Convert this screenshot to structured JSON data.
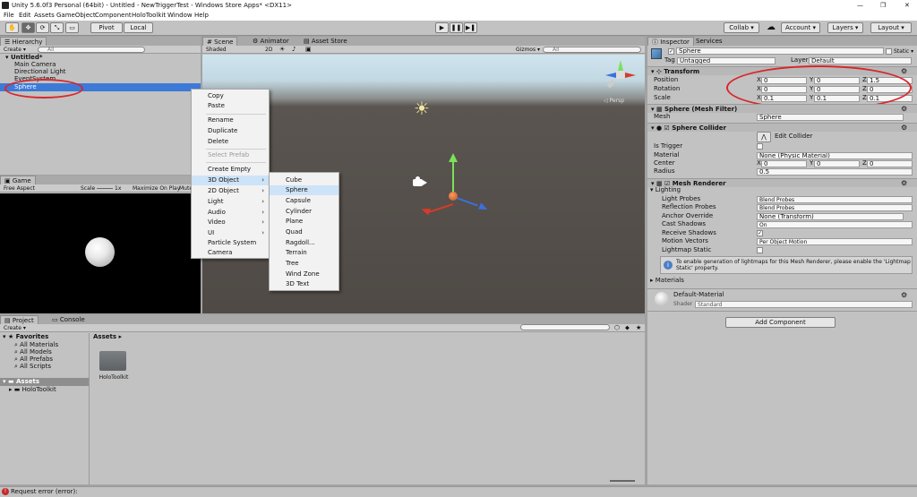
{
  "window": {
    "title": "Unity 5.6.0f3 Personal (64bit) - Untitled - NewTriggerTest - Windows Store Apps* <DX11>",
    "controls": [
      "—",
      "❐",
      "✕"
    ]
  },
  "menubar": [
    "File",
    "Edit",
    "Assets",
    "GameObject",
    "Component",
    "HoloToolkit",
    "Window",
    "Help"
  ],
  "toolbar": {
    "tools": [
      "✋",
      "✥",
      "⟳",
      "⤡",
      "▭"
    ],
    "pivot": "Pivot",
    "local": "Local",
    "play": [
      "▶",
      "❚❚",
      "▶❚"
    ],
    "collab": "Collab ▾",
    "cloud": "☁",
    "account": "Account ▾",
    "layers": "Layers ▾",
    "layout": "Layout ▾"
  },
  "hierarchy": {
    "tab": "Hierarchy",
    "create": "Create ▾",
    "search_placeholder": "All",
    "scene": "Untitled*",
    "items": [
      "Main Camera",
      "Directional Light",
      "EventSystem",
      "Sphere"
    ]
  },
  "game": {
    "tab": "Game",
    "aspect": "Free Aspect",
    "scale_label": "Scale",
    "scale_value": "1x",
    "maximize": "Maximize On Play",
    "mute": "Mute"
  },
  "scene": {
    "tabs": [
      "Scene",
      "Animator",
      "Asset Store"
    ],
    "shading": "Shaded",
    "mode_2d": "2D",
    "gizmos": "Gizmos ▾",
    "search_placeholder": "All",
    "persp": "◁ Persp"
  },
  "context_menu": {
    "items": [
      "Copy",
      "Paste",
      "Rename",
      "Duplicate",
      "Delete",
      "Select Prefab",
      "Create Empty",
      "3D Object",
      "2D Object",
      "Light",
      "Audio",
      "Video",
      "UI",
      "Particle System",
      "Camera"
    ],
    "arrow": "›"
  },
  "submenu_3d": {
    "items": [
      "Cube",
      "Sphere",
      "Capsule",
      "Cylinder",
      "Plane",
      "Quad",
      "Ragdoll...",
      "Terrain",
      "Tree",
      "Wind Zone",
      "3D Text"
    ]
  },
  "inspector": {
    "tabs": [
      "Inspector",
      "Services"
    ],
    "object_name": "Sphere",
    "static": "Static ▾",
    "tag_label": "Tag",
    "tag_value": "Untagged",
    "layer_label": "Layer",
    "layer_value": "Default",
    "transform": {
      "header": "Transform",
      "position_label": "Position",
      "rotation_label": "Rotation",
      "scale_label": "Scale",
      "position": [
        "0",
        "0",
        "1.5"
      ],
      "rotation": [
        "0",
        "0",
        "0"
      ],
      "scale": [
        "0.1",
        "0.1",
        "0.1"
      ],
      "axes": [
        "X",
        "Y",
        "Z"
      ]
    },
    "mesh_filter": {
      "header": "Sphere (Mesh Filter)",
      "mesh_label": "Mesh",
      "mesh_value": "Sphere"
    },
    "collider": {
      "header": "Sphere Collider",
      "edit_label": "Edit Collider",
      "is_trigger": "Is Trigger",
      "material_label": "Material",
      "material_value": "None (Physic Material)",
      "center_label": "Center",
      "center": [
        "0",
        "0",
        "0"
      ],
      "radius_label": "Radius",
      "radius_value": "0.5"
    },
    "renderer": {
      "header": "Mesh Renderer",
      "lighting": "Lighting",
      "light_probes_label": "Light Probes",
      "light_probes_value": "Blend Probes",
      "reflection_probes_label": "Reflection Probes",
      "reflection_probes_value": "Blend Probes",
      "anchor_label": "Anchor Override",
      "anchor_value": "None (Transform)",
      "cast_label": "Cast Shadows",
      "cast_value": "On",
      "receive_label": "Receive Shadows",
      "motion_label": "Motion Vectors",
      "motion_value": "Per Object Motion",
      "lightmap_label": "Lightmap Static",
      "info": "To enable generation of lightmaps for this Mesh Renderer, please enable the 'Lightmap Static' property.",
      "materials": "Materials"
    },
    "material": {
      "name": "Default-Material",
      "shader_label": "Shader",
      "shader_value": "Standard"
    },
    "add_component": "Add Component"
  },
  "project": {
    "tabs": [
      "Project",
      "Console"
    ],
    "create": "Create ▾",
    "favorites": "Favorites",
    "fav_items": [
      "All Materials",
      "All Models",
      "All Prefabs",
      "All Scripts"
    ],
    "assets": "Assets",
    "asset_children": [
      "HoloToolkit"
    ],
    "breadcrumb": "Assets ▸",
    "folder_name": "HoloToolkit"
  },
  "status": {
    "message": "Request error (error):",
    "icon": "!"
  },
  "colors": {
    "selection": "#3d7ad8",
    "annotation_red": "#d8262b",
    "error_red": "#c62828"
  }
}
